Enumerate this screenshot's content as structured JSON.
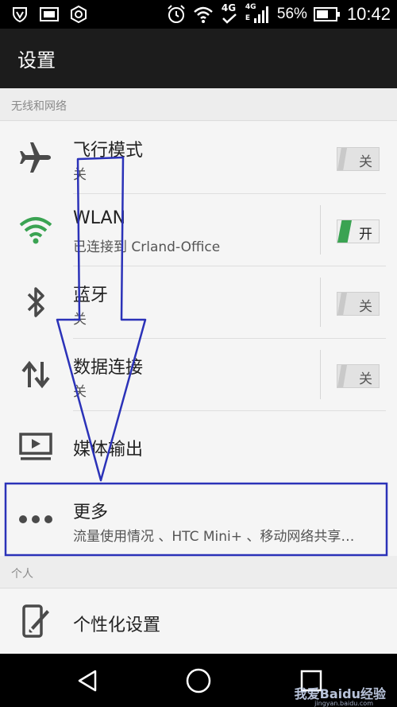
{
  "status_bar": {
    "network": "4G",
    "signal_label": "4G",
    "battery_percent": "56%",
    "time": "10:42"
  },
  "app_bar": {
    "title": "设置"
  },
  "sections": {
    "wireless": "无线和网络",
    "personal": "个人"
  },
  "rows": [
    {
      "title": "飞行模式",
      "subtitle": "关",
      "toggle": "关",
      "icon": "airplane-icon"
    },
    {
      "title": "WLAN",
      "subtitle": "已连接到 Crland-Office",
      "toggle": "开",
      "icon": "wifi-icon"
    },
    {
      "title": "蓝牙",
      "subtitle": "关",
      "toggle": "关",
      "icon": "bluetooth-icon"
    },
    {
      "title": "数据连接",
      "subtitle": "关",
      "toggle": "关",
      "icon": "data-arrows-icon"
    },
    {
      "title": "媒体输出",
      "icon": "media-output-icon"
    },
    {
      "title": "更多",
      "subtitle": "流量使用情况 、HTC Mini+ 、移动网络共享…",
      "icon": "more-dots-icon"
    }
  ],
  "personal_rows": [
    {
      "title": "个性化设置",
      "icon": "personalize-icon"
    }
  ],
  "watermark": {
    "text": "我爱Baidu经验",
    "url": "jingyan.baidu.com"
  },
  "colors": {
    "accent_green": "#3aa352",
    "annotation_blue": "#2b32b8",
    "wifi_green": "#3aa352"
  }
}
